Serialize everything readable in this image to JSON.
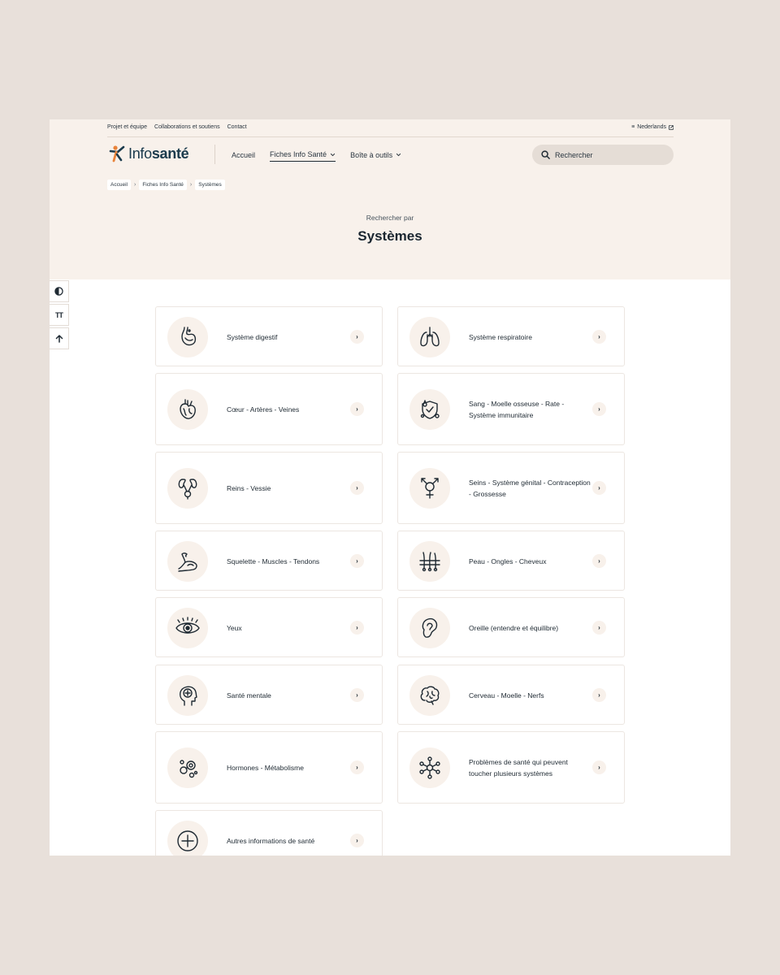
{
  "topbar": {
    "links": [
      "Projet et équipe",
      "Collaborations et soutiens",
      "Contact"
    ],
    "language": "Nederlands"
  },
  "logo": {
    "part1": "Info",
    "part2": "santé"
  },
  "nav": {
    "items": [
      {
        "label": "Accueil"
      },
      {
        "label": "Fiches Info Santé"
      },
      {
        "label": "Boîte à outils"
      }
    ]
  },
  "search": {
    "placeholder": "Rechercher"
  },
  "breadcrumb": [
    "Accueil",
    "Fiches Info Santé",
    "Systèmes"
  ],
  "hero": {
    "subtitle": "Rechercher par",
    "title": "Systèmes"
  },
  "tools": {
    "contrast_icon": "contrast-icon",
    "text_size_label": "TT",
    "top_icon": "arrow-up-icon"
  },
  "systems": [
    {
      "label": "Système digestif",
      "icon": "stomach-icon"
    },
    {
      "label": "Système respiratoire",
      "icon": "lungs-icon"
    },
    {
      "label": "Cœur - Artères - Veines",
      "icon": "heart-icon"
    },
    {
      "label": "Sang - Moelle osseuse - Rate - Système immunitaire",
      "icon": "blood-shield-icon"
    },
    {
      "label": "Reins - Vessie",
      "icon": "kidneys-icon"
    },
    {
      "label": "Seins - Système génital - Contraception - Grossesse",
      "icon": "gender-symbol-icon"
    },
    {
      "label": "Squelette - Muscles - Tendons",
      "icon": "muscle-arm-icon"
    },
    {
      "label": "Peau - Ongles - Cheveux",
      "icon": "skin-hair-icon"
    },
    {
      "label": "Yeux",
      "icon": "eye-icon"
    },
    {
      "label": "Oreille (entendre et équilibre)",
      "icon": "ear-icon"
    },
    {
      "label": "Santé mentale",
      "icon": "head-mind-icon"
    },
    {
      "label": "Cerveau - Moelle - Nerfs",
      "icon": "brain-icon"
    },
    {
      "label": "Hormones - Métabolisme",
      "icon": "hormones-icon"
    },
    {
      "label": "Problèmes de santé qui peuvent toucher plusieurs systèmes",
      "icon": "network-icon"
    },
    {
      "label": "Autres informations de santé",
      "icon": "plus-circle-icon"
    }
  ],
  "arrow_glyph": "›",
  "colors": {
    "hero_bg": "#f8f1eb",
    "page_bg": "#e8e0da",
    "accent_orange": "#e8833a",
    "brand_navy": "#1a3a4c"
  }
}
